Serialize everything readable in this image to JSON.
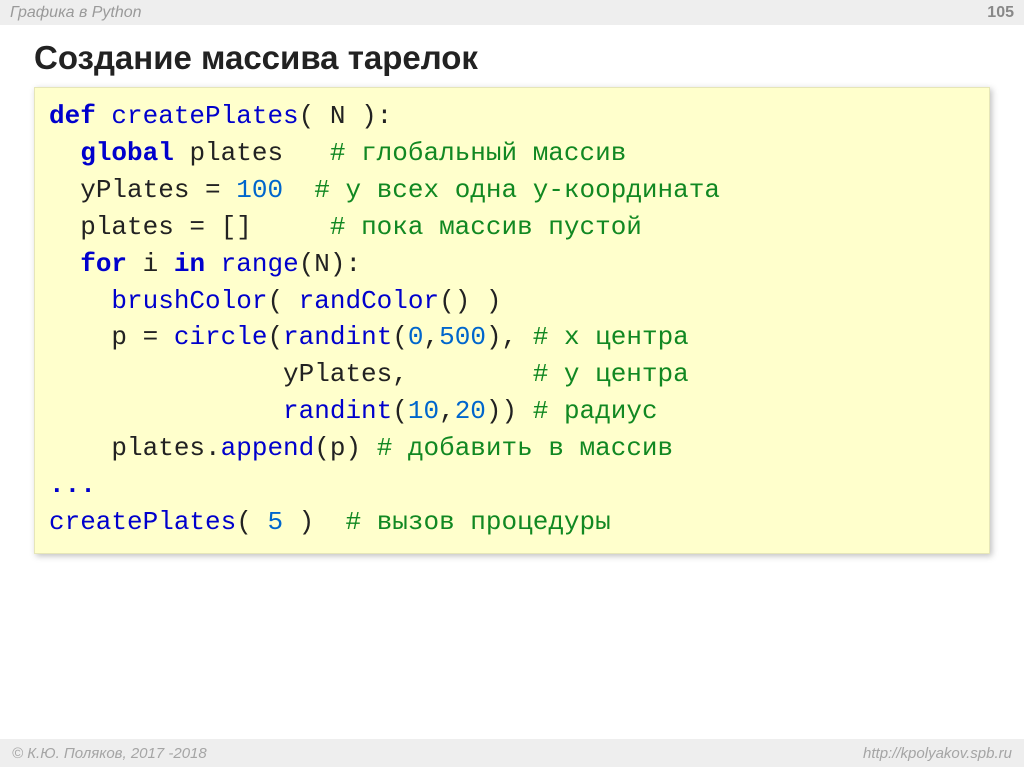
{
  "header": {
    "topic": "Графика в Python",
    "page": "105"
  },
  "title": "Создание массива тарелок",
  "code": {
    "l1": {
      "def": "def",
      "fname": "createPlates",
      "open": "( N ):"
    },
    "l2": {
      "kw": "global",
      "var": " plates   ",
      "cmt": "# глобальный массив"
    },
    "l3": {
      "indent": "  ",
      "lhs": "yPlates = ",
      "num": "100",
      "pad": "  ",
      "cmt": "# у всех одна y-координата"
    },
    "l4": {
      "indent": "  ",
      "lhs": "plates = []     ",
      "cmt": "# пока массив пустой"
    },
    "l5": {
      "for": "for",
      "mid": " i ",
      "in": "in",
      "space": " ",
      "range": "range",
      "tail": "(N):"
    },
    "l6": {
      "indent": "    ",
      "fn1": "brushColor",
      "mid": "( ",
      "fn2": "randColor",
      "tail": "() )"
    },
    "l7": {
      "indent": "    ",
      "lhs": "p = ",
      "fn1": "circle",
      "open": "(",
      "fn2": "randint",
      "args": "(",
      "n1": "0",
      "comma": ",",
      "n2": "500",
      "close": "), ",
      "cmt": "# x центра"
    },
    "l8": {
      "indent": "               ",
      "var": "yPlates,        ",
      "cmt": "# y центра"
    },
    "l9": {
      "indent": "               ",
      "fn": "randint",
      "open": "(",
      "n1": "10",
      "comma": ",",
      "n2": "20",
      "close": ")) ",
      "cmt": "# радиус"
    },
    "l10": {
      "indent": "    ",
      "obj": "plates.",
      "fn": "append",
      "args": "(p) ",
      "cmt": "# добавить в массив"
    },
    "l11": {
      "dots": "..."
    },
    "l12": {
      "fn": "createPlates",
      "args": "( ",
      "n": "5",
      "close": " )  ",
      "cmt": "# вызов процедуры"
    }
  },
  "footer": {
    "copyright": "© К.Ю. Поляков, 2017 -2018",
    "url": "http://kpolyakov.spb.ru"
  }
}
